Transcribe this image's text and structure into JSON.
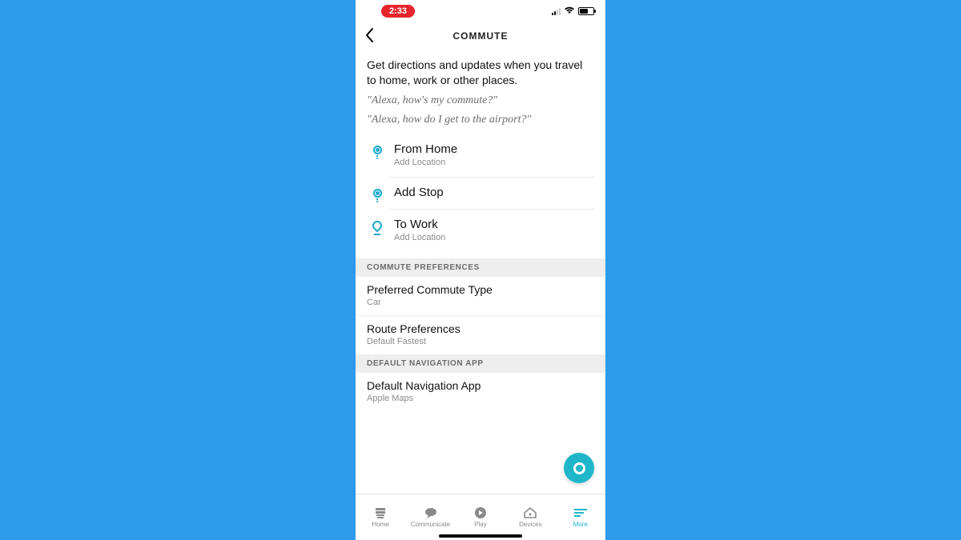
{
  "status": {
    "time": "2:33"
  },
  "header": {
    "title": "COMMUTE"
  },
  "intro": {
    "text": "Get directions and updates when you travel to home, work or other places.",
    "example1": "\"Alexa, how's my commute?\"",
    "example2": "\"Alexa, how do I get to the airport?\""
  },
  "route": {
    "from": {
      "title": "From Home",
      "sub": "Add Location"
    },
    "stop": {
      "title": "Add Stop"
    },
    "to": {
      "title": "To Work",
      "sub": "Add Location"
    }
  },
  "sections": {
    "prefs_header": "COMMUTE PREFERENCES",
    "nav_header": "DEFAULT NAVIGATION APP"
  },
  "prefs": {
    "commute_type": {
      "title": "Preferred Commute Type",
      "value": "Car"
    },
    "route_prefs": {
      "title": "Route Preferences",
      "value": "Default Fastest"
    },
    "nav_app": {
      "title": "Default Navigation App",
      "value": "Apple Maps"
    }
  },
  "tabs": {
    "home": "Home",
    "communicate": "Communicate",
    "play": "Play",
    "devices": "Devices",
    "more": "More"
  },
  "colors": {
    "accent": "#1fb6c9"
  }
}
